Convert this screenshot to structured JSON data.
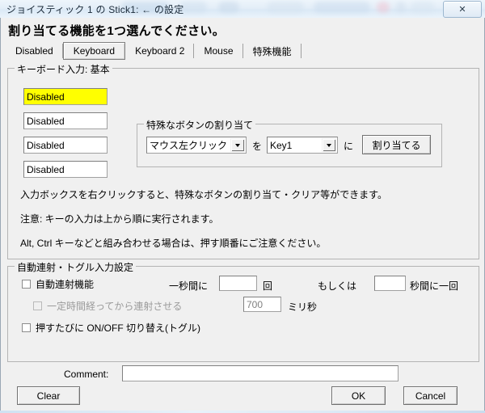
{
  "window": {
    "title": "ジョイスティック 1 の Stick1: ← の設定",
    "close_label": "✕"
  },
  "heading": "割り当てる機能を1つ選んでください。",
  "tabs": [
    {
      "label": "Disabled",
      "selected": false
    },
    {
      "label": "Keyboard",
      "selected": true
    },
    {
      "label": "Keyboard 2",
      "selected": false
    },
    {
      "label": "Mouse",
      "selected": false
    },
    {
      "label": "特殊機能",
      "selected": false
    }
  ],
  "keyboard_group": {
    "title": "キーボード入力: 基本",
    "key_inputs": [
      {
        "value": "Disabled",
        "highlighted": true
      },
      {
        "value": "Disabled",
        "highlighted": false
      },
      {
        "value": "Disabled",
        "highlighted": false
      },
      {
        "value": "Disabled",
        "highlighted": false
      }
    ],
    "special_assign": {
      "title": "特殊なボタンの割り当て",
      "button_combo_value": "マウス左クリック",
      "connector_wo": "を",
      "key_combo_value": "Key1",
      "connector_ni": "に",
      "assign_button": "割り当てる"
    },
    "notes": [
      "入力ボックスを右クリックすると、特殊なボタンの割り当て・クリア等ができます。",
      "注意: キーの入力は上から順に実行されます。",
      "Alt, Ctrl キーなどと組み合わせる場合は、押す順番にご注意ください。"
    ]
  },
  "autofire_group": {
    "title": "自動連射・トグル入力設定",
    "autofire_checkbox": {
      "label": "自動連射機能",
      "checked": false
    },
    "rate_prefix": "一秒間に",
    "rate_value": "",
    "rate_unit": "回",
    "or_label": "もしくは",
    "interval_value": "",
    "interval_unit": "秒間に一回",
    "delay_checkbox": {
      "label": "一定時間経ってから連射させる",
      "checked": false,
      "disabled": true
    },
    "delay_value": "700",
    "delay_unit": "ミリ秒",
    "toggle_checkbox": {
      "label": "押すたびに ON/OFF 切り替え(トグル)",
      "checked": false
    }
  },
  "footer": {
    "comment_label": "Comment:",
    "comment_value": "",
    "clear_button": "Clear",
    "ok_button": "OK",
    "cancel_button": "Cancel"
  }
}
